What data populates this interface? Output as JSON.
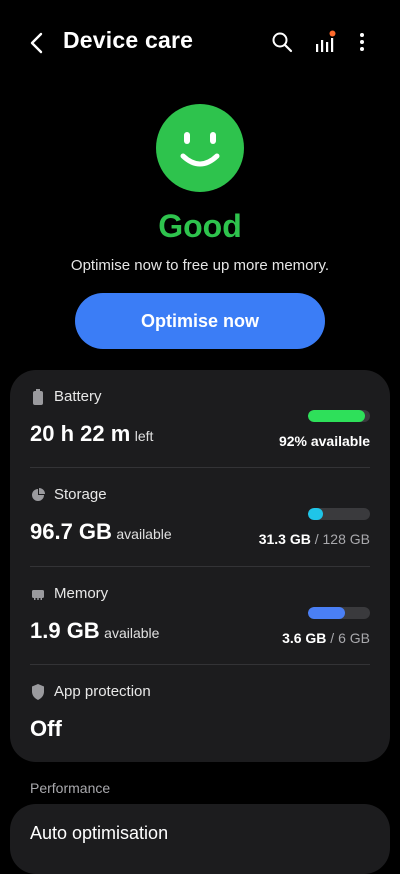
{
  "header": {
    "title": "Device care",
    "back_icon": "chevron-left-icon",
    "search_icon": "search-icon",
    "chart_icon": "signal-bars-icon",
    "more_icon": "more-vertical-icon",
    "notification_dot_color": "#ff6a2b"
  },
  "status": {
    "word": "Good",
    "message": "Optimise now to free up more memory.",
    "face_icon": "smiley-face-icon",
    "color": "#2ec34d"
  },
  "optimise_button": {
    "label": "Optimise now",
    "color": "#3b7df6"
  },
  "battery": {
    "label": "Battery",
    "value": "20 h 22 m",
    "unit": "left",
    "percent_text": "92% available",
    "level_fraction": 0.92,
    "bar_color": "#2ee05a"
  },
  "storage": {
    "label": "Storage",
    "value": "96.7 GB",
    "unit": "available",
    "used": "31.3 GB",
    "separator": " / ",
    "total": "128 GB",
    "used_fraction": 0.245,
    "bar_color": "#1fc5e8"
  },
  "memory": {
    "label": "Memory",
    "value": "1.9 GB",
    "unit": "available",
    "used": "3.6 GB",
    "separator": " / ",
    "total": "6 GB",
    "used_fraction": 0.6,
    "bar_color": "#4a7ff5"
  },
  "app_protection": {
    "label": "App protection",
    "value": "Off"
  },
  "performance": {
    "section_label": "Performance",
    "auto_optimisation_label": "Auto optimisation"
  }
}
